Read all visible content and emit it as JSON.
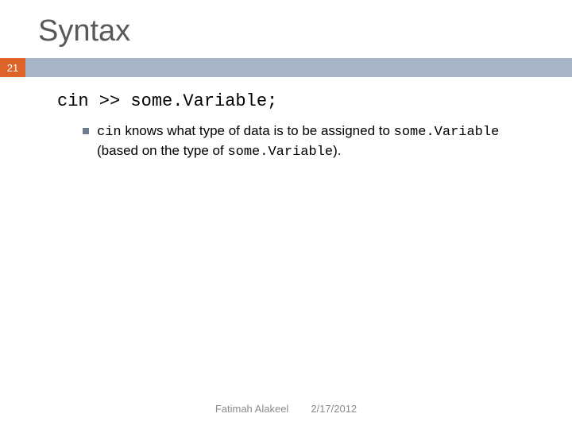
{
  "slide": {
    "title": "Syntax",
    "number": "21"
  },
  "code": {
    "line": "cin >> some.Variable;"
  },
  "bullet": {
    "pre1": "cin",
    "mid1": " knows what type of data is to be assigned to ",
    "pre2": "some.Variable",
    "mid2": " (based on the type of ",
    "pre3": "some.Variable",
    "post": ")."
  },
  "footer": {
    "author": "Fatimah Alakeel",
    "date": "2/17/2012"
  }
}
